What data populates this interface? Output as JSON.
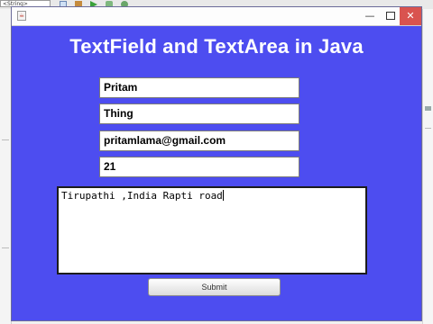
{
  "ide": {
    "run_config_value": "<String>",
    "toolbar_icons": [
      "document-icon",
      "hammer-icon",
      "run-icon",
      "debug-icon",
      "profile-icon"
    ]
  },
  "window": {
    "heading": "TextField and TextArea in Java",
    "controls": {
      "minimize": "—",
      "maximize": "",
      "close": "✕"
    }
  },
  "form": {
    "first_name": "Pritam",
    "last_name": "Thing",
    "email": "pritamlama@gmail.com",
    "age": "21",
    "address": "Tirupathi ,India Rapti road",
    "submit_label": "Submit"
  },
  "colors": {
    "panel_background": "#4d4df0",
    "heading_text": "#ffffff",
    "close_button": "#d9534f"
  }
}
